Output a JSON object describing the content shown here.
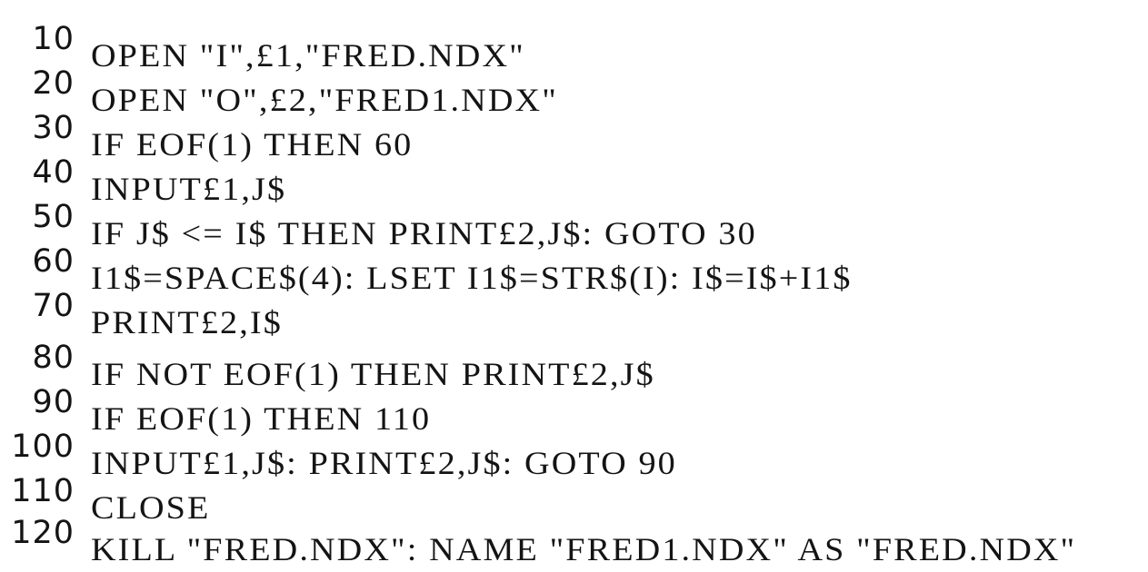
{
  "program": {
    "lines": [
      {
        "num": "10",
        "code": "OPEN \"I\",£1,\"FRED.NDX\""
      },
      {
        "num": "20",
        "code": "OPEN \"O\",£2,\"FRED1.NDX\""
      },
      {
        "num": "30",
        "code": "IF EOF(1) THEN 60"
      },
      {
        "num": "40",
        "code": "INPUT£1,J$"
      },
      {
        "num": "50",
        "code": "IF J$ <= I$ THEN PRINT£2,J$: GOTO 30"
      },
      {
        "num": "60",
        "code": "I1$=SPACE$(4): LSET I1$=STR$(I): I$=I$+I1$"
      },
      {
        "num": "70",
        "code": "PRINT£2,I$"
      },
      {
        "num": "80",
        "code": "IF NOT EOF(1) THEN PRINT£2,J$"
      },
      {
        "num": "90",
        "code": "IF EOF(1) THEN 110"
      },
      {
        "num": "100",
        "code": "INPUT£1,J$: PRINT£2,J$: GOTO 90"
      },
      {
        "num": "110",
        "code": "CLOSE"
      },
      {
        "num": "120",
        "code": "KILL \"FRED.NDX\": NAME \"FRED1.NDX\" AS \"FRED.NDX\""
      }
    ]
  }
}
